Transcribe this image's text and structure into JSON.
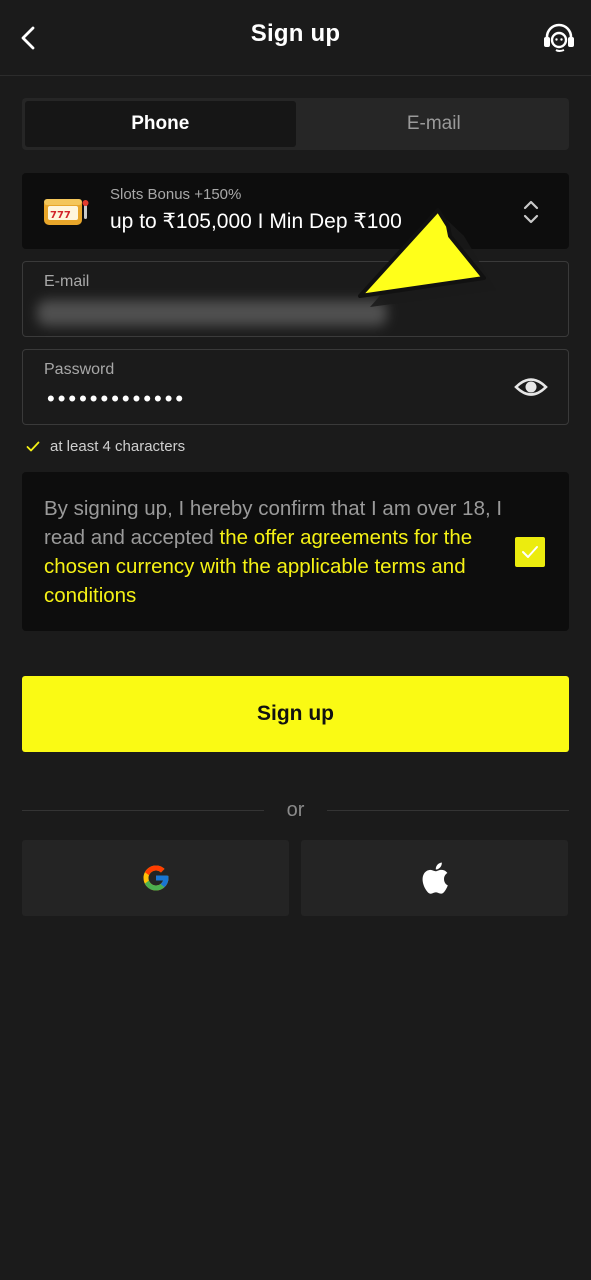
{
  "header": {
    "title": "Sign up"
  },
  "tabs": [
    {
      "label": "Phone",
      "active": true
    },
    {
      "label": "E-mail",
      "active": false
    }
  ],
  "bonus": {
    "subtitle": "Slots Bonus +150%",
    "title": "up to ₹105,000 I Min Dep ₹100",
    "icon": "slot-machine-icon"
  },
  "email_field": {
    "label": "E-mail"
  },
  "password_field": {
    "label": "Password",
    "masked_value": "•••••••••••••"
  },
  "hint": {
    "text": "at least 4 characters"
  },
  "terms": {
    "prefix": "By signing up, I hereby confirm that I am over 18, I read and accepted ",
    "link": "the offer agreements for the chosen currency with the applicable terms and conditions",
    "checked": true
  },
  "signup_button": {
    "label": "Sign up"
  },
  "divider": {
    "text": "or"
  },
  "colors": {
    "accent": "#fafa14",
    "background": "#1b1b1b",
    "panel": "#0d0d0d"
  }
}
